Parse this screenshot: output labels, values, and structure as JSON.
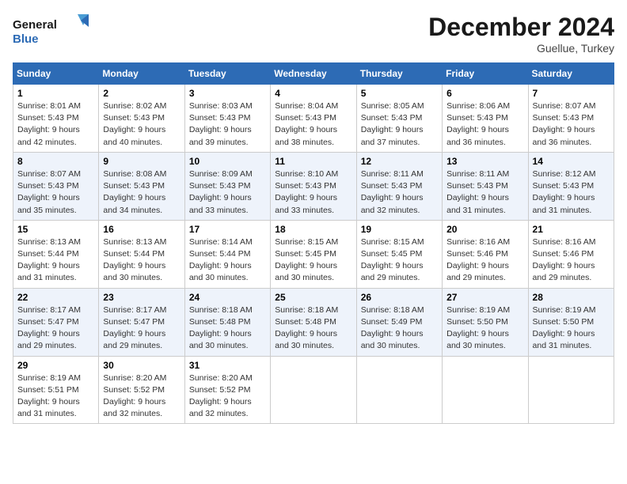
{
  "header": {
    "logo_line1": "General",
    "logo_line2": "Blue",
    "month": "December 2024",
    "location": "Guellue, Turkey"
  },
  "weekdays": [
    "Sunday",
    "Monday",
    "Tuesday",
    "Wednesday",
    "Thursday",
    "Friday",
    "Saturday"
  ],
  "weeks": [
    [
      {
        "day": 1,
        "sunrise": "Sunrise: 8:01 AM",
        "sunset": "Sunset: 5:43 PM",
        "daylight": "Daylight: 9 hours and 42 minutes."
      },
      {
        "day": 2,
        "sunrise": "Sunrise: 8:02 AM",
        "sunset": "Sunset: 5:43 PM",
        "daylight": "Daylight: 9 hours and 40 minutes."
      },
      {
        "day": 3,
        "sunrise": "Sunrise: 8:03 AM",
        "sunset": "Sunset: 5:43 PM",
        "daylight": "Daylight: 9 hours and 39 minutes."
      },
      {
        "day": 4,
        "sunrise": "Sunrise: 8:04 AM",
        "sunset": "Sunset: 5:43 PM",
        "daylight": "Daylight: 9 hours and 38 minutes."
      },
      {
        "day": 5,
        "sunrise": "Sunrise: 8:05 AM",
        "sunset": "Sunset: 5:43 PM",
        "daylight": "Daylight: 9 hours and 37 minutes."
      },
      {
        "day": 6,
        "sunrise": "Sunrise: 8:06 AM",
        "sunset": "Sunset: 5:43 PM",
        "daylight": "Daylight: 9 hours and 36 minutes."
      },
      {
        "day": 7,
        "sunrise": "Sunrise: 8:07 AM",
        "sunset": "Sunset: 5:43 PM",
        "daylight": "Daylight: 9 hours and 36 minutes."
      }
    ],
    [
      {
        "day": 8,
        "sunrise": "Sunrise: 8:07 AM",
        "sunset": "Sunset: 5:43 PM",
        "daylight": "Daylight: 9 hours and 35 minutes."
      },
      {
        "day": 9,
        "sunrise": "Sunrise: 8:08 AM",
        "sunset": "Sunset: 5:43 PM",
        "daylight": "Daylight: 9 hours and 34 minutes."
      },
      {
        "day": 10,
        "sunrise": "Sunrise: 8:09 AM",
        "sunset": "Sunset: 5:43 PM",
        "daylight": "Daylight: 9 hours and 33 minutes."
      },
      {
        "day": 11,
        "sunrise": "Sunrise: 8:10 AM",
        "sunset": "Sunset: 5:43 PM",
        "daylight": "Daylight: 9 hours and 33 minutes."
      },
      {
        "day": 12,
        "sunrise": "Sunrise: 8:11 AM",
        "sunset": "Sunset: 5:43 PM",
        "daylight": "Daylight: 9 hours and 32 minutes."
      },
      {
        "day": 13,
        "sunrise": "Sunrise: 8:11 AM",
        "sunset": "Sunset: 5:43 PM",
        "daylight": "Daylight: 9 hours and 31 minutes."
      },
      {
        "day": 14,
        "sunrise": "Sunrise: 8:12 AM",
        "sunset": "Sunset: 5:43 PM",
        "daylight": "Daylight: 9 hours and 31 minutes."
      }
    ],
    [
      {
        "day": 15,
        "sunrise": "Sunrise: 8:13 AM",
        "sunset": "Sunset: 5:44 PM",
        "daylight": "Daylight: 9 hours and 31 minutes."
      },
      {
        "day": 16,
        "sunrise": "Sunrise: 8:13 AM",
        "sunset": "Sunset: 5:44 PM",
        "daylight": "Daylight: 9 hours and 30 minutes."
      },
      {
        "day": 17,
        "sunrise": "Sunrise: 8:14 AM",
        "sunset": "Sunset: 5:44 PM",
        "daylight": "Daylight: 9 hours and 30 minutes."
      },
      {
        "day": 18,
        "sunrise": "Sunrise: 8:15 AM",
        "sunset": "Sunset: 5:45 PM",
        "daylight": "Daylight: 9 hours and 30 minutes."
      },
      {
        "day": 19,
        "sunrise": "Sunrise: 8:15 AM",
        "sunset": "Sunset: 5:45 PM",
        "daylight": "Daylight: 9 hours and 29 minutes."
      },
      {
        "day": 20,
        "sunrise": "Sunrise: 8:16 AM",
        "sunset": "Sunset: 5:46 PM",
        "daylight": "Daylight: 9 hours and 29 minutes."
      },
      {
        "day": 21,
        "sunrise": "Sunrise: 8:16 AM",
        "sunset": "Sunset: 5:46 PM",
        "daylight": "Daylight: 9 hours and 29 minutes."
      }
    ],
    [
      {
        "day": 22,
        "sunrise": "Sunrise: 8:17 AM",
        "sunset": "Sunset: 5:47 PM",
        "daylight": "Daylight: 9 hours and 29 minutes."
      },
      {
        "day": 23,
        "sunrise": "Sunrise: 8:17 AM",
        "sunset": "Sunset: 5:47 PM",
        "daylight": "Daylight: 9 hours and 29 minutes."
      },
      {
        "day": 24,
        "sunrise": "Sunrise: 8:18 AM",
        "sunset": "Sunset: 5:48 PM",
        "daylight": "Daylight: 9 hours and 30 minutes."
      },
      {
        "day": 25,
        "sunrise": "Sunrise: 8:18 AM",
        "sunset": "Sunset: 5:48 PM",
        "daylight": "Daylight: 9 hours and 30 minutes."
      },
      {
        "day": 26,
        "sunrise": "Sunrise: 8:18 AM",
        "sunset": "Sunset: 5:49 PM",
        "daylight": "Daylight: 9 hours and 30 minutes."
      },
      {
        "day": 27,
        "sunrise": "Sunrise: 8:19 AM",
        "sunset": "Sunset: 5:50 PM",
        "daylight": "Daylight: 9 hours and 30 minutes."
      },
      {
        "day": 28,
        "sunrise": "Sunrise: 8:19 AM",
        "sunset": "Sunset: 5:50 PM",
        "daylight": "Daylight: 9 hours and 31 minutes."
      }
    ],
    [
      {
        "day": 29,
        "sunrise": "Sunrise: 8:19 AM",
        "sunset": "Sunset: 5:51 PM",
        "daylight": "Daylight: 9 hours and 31 minutes."
      },
      {
        "day": 30,
        "sunrise": "Sunrise: 8:20 AM",
        "sunset": "Sunset: 5:52 PM",
        "daylight": "Daylight: 9 hours and 32 minutes."
      },
      {
        "day": 31,
        "sunrise": "Sunrise: 8:20 AM",
        "sunset": "Sunset: 5:52 PM",
        "daylight": "Daylight: 9 hours and 32 minutes."
      },
      null,
      null,
      null,
      null
    ]
  ]
}
